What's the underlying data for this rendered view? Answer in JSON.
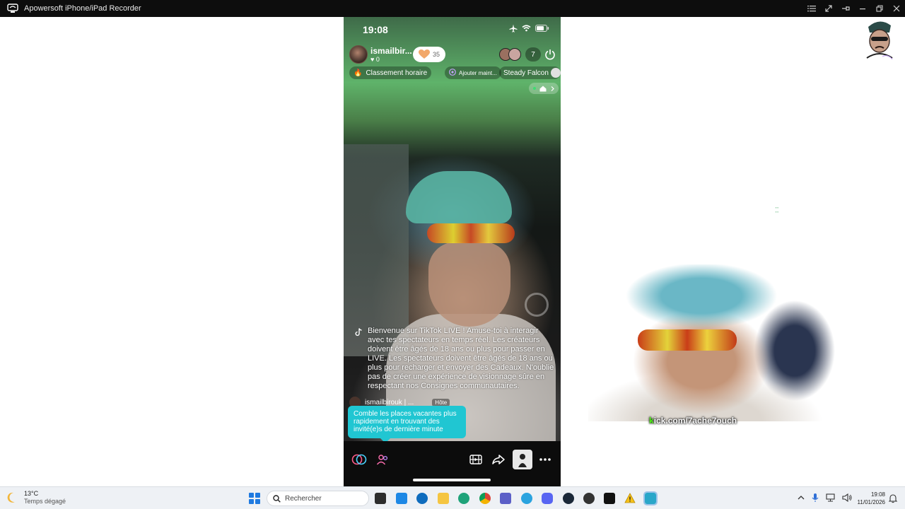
{
  "window": {
    "title": "Apowersoft iPhone/iPad Recorder"
  },
  "phone": {
    "status_time": "19:08",
    "host": {
      "name": "ismailbir...",
      "likes": "0"
    },
    "like_count": "35",
    "viewer_count": "7",
    "chips": {
      "ranking": "Classement horaire",
      "add_guest": "Ajouter maint...",
      "guest_name": "Steady Falcon"
    },
    "welcome_message": "Bienvenue sur TikTok LIVE ! Amuse-toi à interagir avec tes spectateurs en temps réel. Les créateurs doivent être âgés de 18 ans ou plus pour passer en LIVE. Les spectateurs doivent être âgés de 18 ans ou plus pour recharger et envoyer des Cadeaux. N'oublie pas de créer une expérience de visionnage sûre en respectant nos Consignes communautaires.",
    "comment": {
      "user": "ismailbirouk | ...",
      "badge": "Hôte"
    },
    "tooltip": "Comble les places vacantes plus rapidement en trouvant des invité(e)s de dernière minute"
  },
  "overlay": {
    "kick_prefix": "k",
    "kick_rest": "ick.com/7ache7ouch"
  },
  "taskbar": {
    "weather_temp": "13°C",
    "weather_desc": "Temps dégagé",
    "search_placeholder": "Rechercher",
    "clock_time": "19:08",
    "clock_date": "11/01/2026"
  },
  "colors": {
    "tooltip": "#20c6d2",
    "kick_green": "#53fc18",
    "taskbar_bg": "#eef1f5"
  }
}
